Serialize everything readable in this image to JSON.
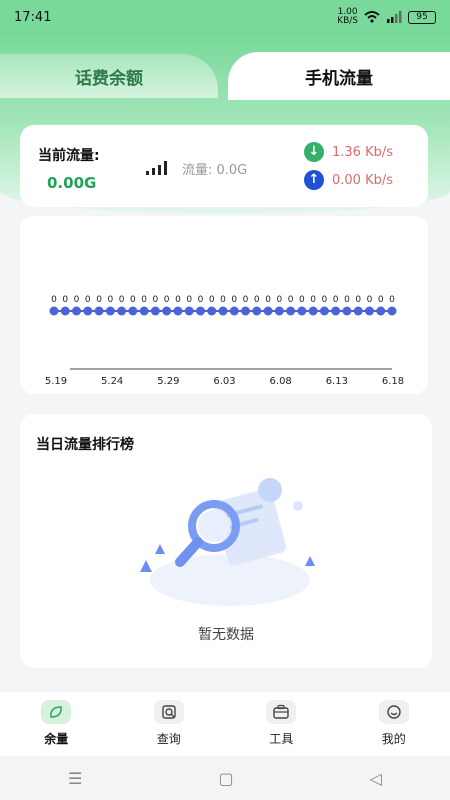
{
  "status_bar": {
    "time": "17:41",
    "net_speed": "1.00\nKB/S",
    "battery": "95"
  },
  "tabs": {
    "left": "话费余额",
    "right": "手机流量"
  },
  "current_flow": {
    "label": "当前流量:",
    "value": "0.00G",
    "flow_label": "流量: 0.0G",
    "download_speed": "1.36 Kb/s",
    "upload_speed": "0.00 Kb/s"
  },
  "chart_data": {
    "type": "line",
    "x_tick_labels": [
      "5.19",
      "5.24",
      "5.29",
      "6.03",
      "6.08",
      "6.13",
      "6.18"
    ],
    "values": [
      0,
      0,
      0,
      0,
      0,
      0,
      0,
      0,
      0,
      0,
      0,
      0,
      0,
      0,
      0,
      0,
      0,
      0,
      0,
      0,
      0,
      0,
      0,
      0,
      0,
      0,
      0,
      0,
      0,
      0,
      0
    ],
    "point_labels": [
      "0",
      "0",
      "0",
      "0",
      "0",
      "0",
      "0",
      "0",
      "0",
      "0",
      "0",
      "0",
      "0",
      "0",
      "0",
      "0",
      "0",
      "0",
      "0",
      "0",
      "0",
      "0",
      "0",
      "0",
      "0",
      "0",
      "0",
      "0",
      "0",
      "0",
      "0"
    ],
    "series_color": "#4b63d8"
  },
  "ranking": {
    "title": "当日流量排行榜",
    "empty_text": "暂无数据"
  },
  "nav": [
    {
      "label": "余量",
      "icon": "leaf-icon"
    },
    {
      "label": "查询",
      "icon": "search-doc-icon"
    },
    {
      "label": "工具",
      "icon": "toolbox-icon"
    },
    {
      "label": "我的",
      "icon": "smile-icon"
    }
  ],
  "system_nav": {
    "menu": "☰",
    "home": "▢",
    "back": "◁"
  }
}
